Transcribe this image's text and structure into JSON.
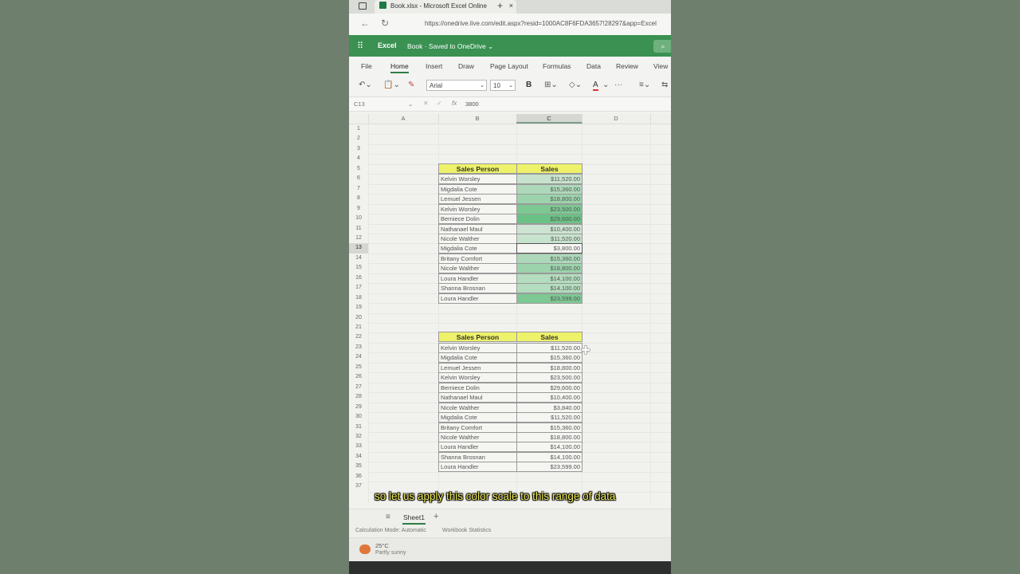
{
  "browser": {
    "tab_title": "Book.xlsx - Microsoft Excel Online",
    "tab_close": "×",
    "new_tab": "+",
    "url": "https://onedrive.live.com/edit.aspx?resid=1000AC8F6FDA3657!28297&app=Excel"
  },
  "excel": {
    "app_name": "Excel",
    "doc_title": "Book · Saved to OneDrive ⌄",
    "search_icon": "search-icon"
  },
  "menu": {
    "tabs": [
      "File",
      "Home",
      "Insert",
      "Draw",
      "Page Layout",
      "Formulas",
      "Data",
      "Review",
      "View"
    ],
    "active": "Home"
  },
  "ribbon": {
    "font_name": "Arial",
    "font_size": "10",
    "bold": "B",
    "font_color_letter": "A"
  },
  "formula_bar": {
    "name_box": "C13",
    "fx": "fx",
    "value": "3800"
  },
  "columns": [
    "A",
    "B",
    "C",
    "D"
  ],
  "selected_column": "C",
  "selected_row": "13",
  "rows": [
    "1",
    "2",
    "3",
    "4",
    "5",
    "6",
    "7",
    "8",
    "9",
    "10",
    "11",
    "12",
    "13",
    "14",
    "15",
    "16",
    "17",
    "18",
    "19",
    "20",
    "21",
    "22",
    "23",
    "24",
    "25",
    "26",
    "27",
    "28",
    "29",
    "30",
    "31",
    "32",
    "33",
    "34",
    "35",
    "36",
    "37"
  ],
  "table1": {
    "header_name": "Sales Person",
    "header_sales": "Sales",
    "rows": [
      {
        "name": "Kelvin Worsley",
        "sales": "$11,520.00",
        "scale": 0.25
      },
      {
        "name": "Migdalia Cote",
        "sales": "$15,360.00",
        "scale": 0.45
      },
      {
        "name": "Lemuel Jessen",
        "sales": "$18,800.00",
        "scale": 0.6
      },
      {
        "name": "Kelvin Worsley",
        "sales": "$23,500.00",
        "scale": 0.85
      },
      {
        "name": "Berniece Dolin",
        "sales": "$29,600.00",
        "scale": 1.0
      },
      {
        "name": "Nathanael Maul",
        "sales": "$10,400.00",
        "scale": 0.2
      },
      {
        "name": "Nicole Walther",
        "sales": "$11,520.00",
        "scale": 0.25
      },
      {
        "name": "Migdalia Cote",
        "sales": "$3,800.00",
        "scale": 0.0
      },
      {
        "name": "Britany Comfort",
        "sales": "$15,360.00",
        "scale": 0.45
      },
      {
        "name": "Nicole Walther",
        "sales": "$18,800.00",
        "scale": 0.6
      },
      {
        "name": "Loura Handler",
        "sales": "$14,100.00",
        "scale": 0.4
      },
      {
        "name": "Shanna Brosnan",
        "sales": "$14,100.00",
        "scale": 0.4
      },
      {
        "name": "Loura Handler",
        "sales": "$23,599.00",
        "scale": 0.85
      }
    ]
  },
  "table2": {
    "header_name": "Sales Person",
    "header_sales": "Sales",
    "rows": [
      {
        "name": "Kelvin Worsley",
        "sales": "$11,520.00"
      },
      {
        "name": "Migdalia Cote",
        "sales": "$15,360.00"
      },
      {
        "name": "Lemuel Jessen",
        "sales": "$18,800.00"
      },
      {
        "name": "Kelvin Worsley",
        "sales": "$23,500.00"
      },
      {
        "name": "Berniece Dolin",
        "sales": "$29,600.00"
      },
      {
        "name": "Nathanael Maul",
        "sales": "$10,400.00"
      },
      {
        "name": "Nicole Walther",
        "sales": "$3,840.00"
      },
      {
        "name": "Migdalia Cote",
        "sales": "$11,520.00"
      },
      {
        "name": "Britany Comfort",
        "sales": "$15,360.00"
      },
      {
        "name": "Nicole Walther",
        "sales": "$18,800.00"
      },
      {
        "name": "Loura Handler",
        "sales": "$14,100.00"
      },
      {
        "name": "Shanna Brosnan",
        "sales": "$14,100.00"
      },
      {
        "name": "Loura Handler",
        "sales": "$23,599.00"
      }
    ]
  },
  "sheet": {
    "tab_name": "Sheet1",
    "add": "+"
  },
  "status": {
    "calc_mode": "Calculation Mode: Automatic",
    "workbook_stats": "Workbook Statistics"
  },
  "weather": {
    "temp": "25°C",
    "condition": "Partly sunny"
  },
  "caption": "so let us apply this color scale to this range of data",
  "colors": {
    "excel_green": "#3a9152",
    "header_yellow": "#eef26a",
    "scale_green": "#5cbd7a",
    "caption_yellow": "#f4ef5a"
  }
}
